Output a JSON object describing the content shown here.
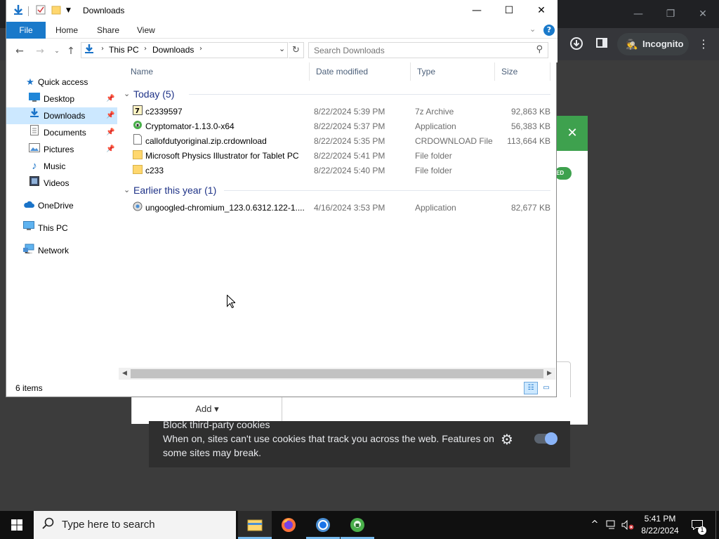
{
  "chrome": {
    "minimize": "—",
    "restore": "❐",
    "close": "✕",
    "incognito_label": "Incognito",
    "green_close": "✕",
    "badge_text": "ED",
    "add_label": "Add ▾",
    "cookies_title": "Block third-party cookies",
    "cookies_desc": "When on, sites can't use cookies that track you across the web. Features on some sites may break."
  },
  "explorer": {
    "title": "Downloads",
    "ribbon_tabs": [
      "File",
      "Home",
      "Share",
      "View"
    ],
    "address": {
      "crumbs": [
        "This PC",
        "Downloads"
      ]
    },
    "search_placeholder": "Search Downloads",
    "nav_pane": [
      {
        "label": "Quick access",
        "icon": "star-icon",
        "pinned": false
      },
      {
        "label": "Desktop",
        "icon": "desktop-icon",
        "pinned": true
      },
      {
        "label": "Downloads",
        "icon": "download-icon",
        "pinned": true,
        "selected": true
      },
      {
        "label": "Documents",
        "icon": "documents-icon",
        "pinned": true
      },
      {
        "label": "Pictures",
        "icon": "pictures-icon",
        "pinned": true
      },
      {
        "label": "Music",
        "icon": "music-icon",
        "pinned": false
      },
      {
        "label": "Videos",
        "icon": "videos-icon",
        "pinned": false
      },
      {
        "label": "OneDrive",
        "icon": "cloud-icon",
        "pinned": false
      },
      {
        "label": "This PC",
        "icon": "computer-icon",
        "pinned": false
      },
      {
        "label": "Network",
        "icon": "network-icon",
        "pinned": false
      }
    ],
    "columns": [
      "Name",
      "Date modified",
      "Type",
      "Size"
    ],
    "groups": [
      {
        "label": "Today (5)",
        "files": [
          {
            "name": "c2339597",
            "date": "8/22/2024 5:39 PM",
            "type": "7z Archive",
            "size": "92,863 KB",
            "icon": "archive-icon"
          },
          {
            "name": "Cryptomator-1.13.0-x64",
            "date": "8/22/2024 5:37 PM",
            "type": "Application",
            "size": "56,383 KB",
            "icon": "app-icon"
          },
          {
            "name": "callofdutyoriginal.zip.crdownload",
            "date": "8/22/2024 5:35 PM",
            "type": "CRDOWNLOAD File",
            "size": "113,664 KB",
            "icon": "file-icon"
          },
          {
            "name": "Microsoft Physics Illustrator for Tablet PC",
            "date": "8/22/2024 5:41 PM",
            "type": "File folder",
            "size": "",
            "icon": "folder-icon"
          },
          {
            "name": "c233",
            "date": "8/22/2024 5:40 PM",
            "type": "File folder",
            "size": "",
            "icon": "folder-icon"
          }
        ]
      },
      {
        "label": "Earlier this year (1)",
        "files": [
          {
            "name": "ungoogled-chromium_123.0.6312.122-1....",
            "date": "4/16/2024 3:53 PM",
            "type": "Application",
            "size": "82,677 KB",
            "icon": "installer-icon"
          }
        ]
      }
    ],
    "status_count": "6 items"
  },
  "taskbar": {
    "search_placeholder": "Type here to search",
    "time": "5:41 PM",
    "date": "8/22/2024",
    "notification_count": "1"
  }
}
